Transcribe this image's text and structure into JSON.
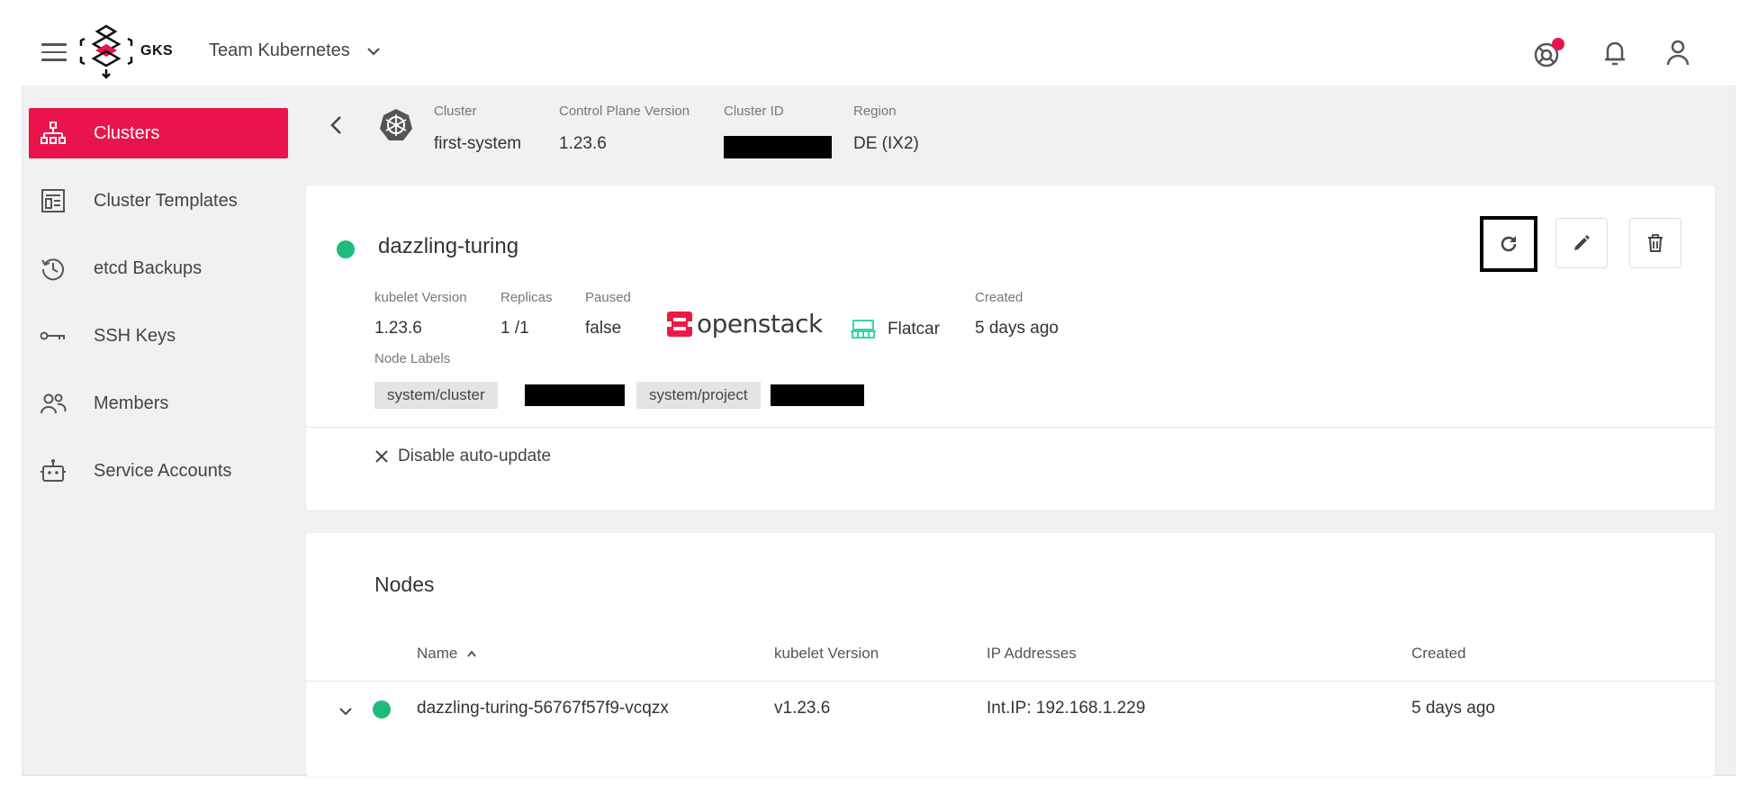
{
  "header": {
    "logo_text": "GKS",
    "team_name": "Team Kubernetes"
  },
  "sidebar": {
    "items": [
      {
        "label": "Clusters",
        "icon": "sitemap-icon",
        "active": true
      },
      {
        "label": "Cluster Templates",
        "icon": "template-icon"
      },
      {
        "label": "etcd Backups",
        "icon": "history-icon"
      },
      {
        "label": "SSH Keys",
        "icon": "key-icon"
      },
      {
        "label": "Members",
        "icon": "members-icon"
      },
      {
        "label": "Service Accounts",
        "icon": "robot-icon"
      }
    ]
  },
  "cluster_meta": {
    "cluster_label": "Cluster",
    "cluster_value": "first-system",
    "cp_label": "Control Plane Version",
    "cp_value": "1.23.6",
    "id_label": "Cluster ID",
    "region_label": "Region",
    "region_value": "DE (IX2)"
  },
  "md_card": {
    "name": "dazzling-turing",
    "status_color": "#1cbc7c",
    "kubelet_label": "kubelet Version",
    "kubelet_value": "1.23.6",
    "replicas_label": "Replicas",
    "replicas_value": "1 /1",
    "paused_label": "Paused",
    "paused_value": "false",
    "provider": "openstack",
    "os": "Flatcar",
    "created_label": "Created",
    "created_value": "5 days ago",
    "node_labels_label": "Node Labels",
    "chips": [
      "system/cluster",
      "system/project"
    ],
    "disable_auto_update": "Disable auto-update"
  },
  "nodes": {
    "title": "Nodes",
    "columns": {
      "name": "Name",
      "kubelet": "kubelet Version",
      "ip": "IP Addresses",
      "created": "Created"
    },
    "rows": [
      {
        "name": "dazzling-turing-56767f57f9-vcqzx",
        "kubelet": "v1.23.6",
        "ip": "Int.IP: 192.168.1.229",
        "created": "5 days ago"
      }
    ]
  },
  "colors": {
    "accent": "#e8144b",
    "status_ok": "#1cbc7c",
    "openstack": "#ed1944",
    "flatcar": "#3bd5a5"
  }
}
